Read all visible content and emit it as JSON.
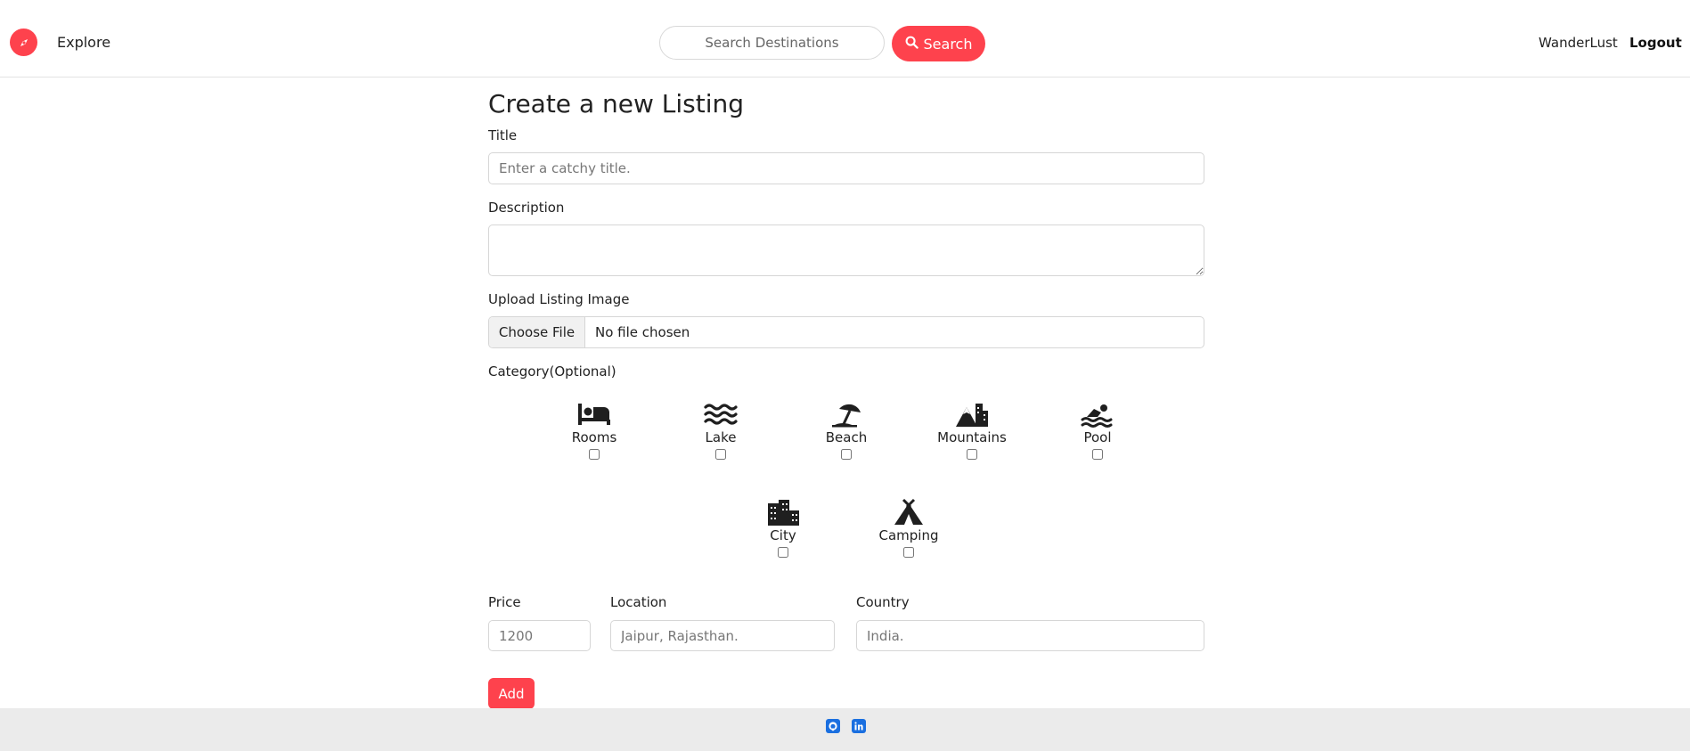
{
  "navbar": {
    "explore_label": "Explore",
    "search_placeholder": "Search Destinations",
    "search_button_label": "Search",
    "user_label": "WanderLust",
    "logout_label": "Logout"
  },
  "form": {
    "heading": "Create a new Listing",
    "title_label": "Title",
    "title_placeholder": "Enter a catchy title.",
    "description_label": "Description",
    "image_label": "Upload Listing Image",
    "choose_file_label": "Choose File",
    "file_status": "No file chosen",
    "category_label": "Category(Optional)",
    "categories": [
      {
        "label": "Rooms",
        "icon": "bed-icon"
      },
      {
        "label": "Lake",
        "icon": "water-icon"
      },
      {
        "label": "Beach",
        "icon": "umbrella-beach-icon"
      },
      {
        "label": "Mountains",
        "icon": "mountain-city-icon"
      },
      {
        "label": "Pool",
        "icon": "person-swimming-icon"
      },
      {
        "label": "City",
        "icon": "city-icon"
      },
      {
        "label": "Camping",
        "icon": "tent-icon"
      }
    ],
    "price_label": "Price",
    "price_placeholder": "1200",
    "location_label": "Location",
    "location_placeholder": "Jaipur, Rajasthan.",
    "country_label": "Country",
    "country_placeholder": "India.",
    "add_button_label": "Add"
  },
  "footer": {
    "icons": [
      "github-icon",
      "linkedin-icon"
    ]
  },
  "colors": {
    "brand": "#fe424d",
    "footer_bg": "#ebebeb",
    "social_icon": "#1a6fe0"
  }
}
